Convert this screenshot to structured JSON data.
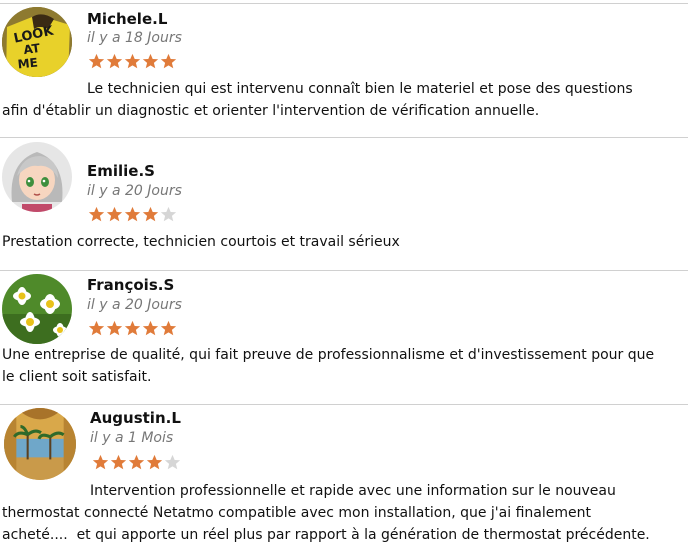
{
  "reviews": [
    {
      "name": "Michele.L",
      "date": "il y a 18 Jours",
      "rating": 5,
      "max_rating": 5,
      "avatar_icon": "look-at-me-shirt-photo",
      "text_lines": [
        "Le technicien qui est intervenu connaît bien le materiel et pose des questions",
        "afin d'établir un diagnostic et orienter l'intervention de vérification annuelle."
      ]
    },
    {
      "name": "Emilie.S",
      "date": "il y a 20 Jours",
      "rating": 4,
      "max_rating": 5,
      "avatar_icon": "anime-girl-avatar",
      "text_lines": [
        "Prestation correcte, technicien courtois et travail sérieux"
      ]
    },
    {
      "name": "François.S",
      "date": "il y a 20 Jours",
      "rating": 5,
      "max_rating": 5,
      "avatar_icon": "daisy-flowers-photo",
      "text_lines": [
        "Une entreprise de qualité, qui fait preuve de professionnalisme et d'investissement pour que",
        "le client soit satisfait."
      ]
    },
    {
      "name": "Augustin.L",
      "date": "il y a 1 Mois",
      "rating": 4,
      "max_rating": 5,
      "avatar_icon": "palm-tree-terrace-painting",
      "text_lines": [
        "Intervention professionnelle et rapide avec une information sur le nouveau",
        "thermostat connecté Netatmo compatible avec mon installation, que j'ai finalement",
        "acheté....  et qui apporte un réel plus par rapport à la génération de thermostat précédente."
      ]
    }
  ],
  "colors": {
    "star_filled": "#e07b3a",
    "star_empty": "#d6d6d6",
    "divider": "#d0d0d0",
    "date_text": "#777777"
  }
}
